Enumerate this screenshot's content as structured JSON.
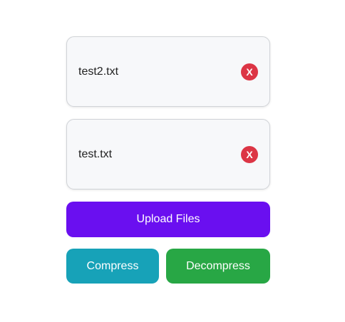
{
  "files": [
    {
      "name": "test2.txt",
      "remove_label": "X"
    },
    {
      "name": "test.txt",
      "remove_label": "X"
    }
  ],
  "actions": {
    "upload_label": "Upload Files",
    "compress_label": "Compress",
    "decompress_label": "Decompress"
  },
  "colors": {
    "upload": "#6a0ff0",
    "compress": "#17a2b8",
    "decompress": "#28a745",
    "remove": "#dc3545"
  }
}
